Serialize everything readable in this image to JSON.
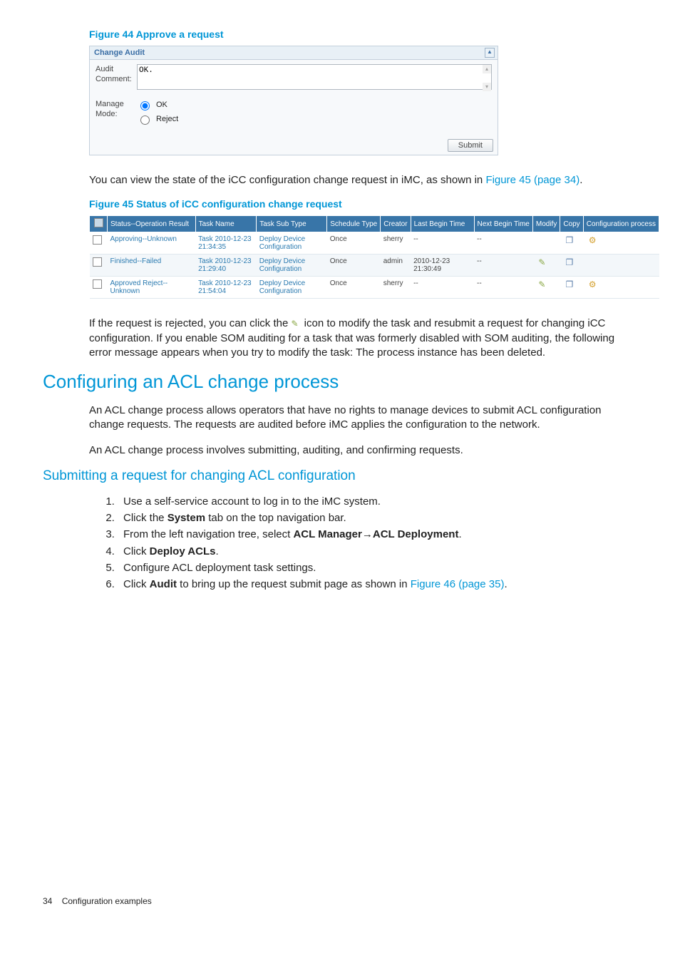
{
  "figure44": {
    "caption": "Figure 44 Approve a request",
    "panelTitle": "Change Audit",
    "auditCommentLabel": "Audit Comment:",
    "auditCommentValue": "OK.",
    "manageModeLabel": "Manage Mode:",
    "modeOK": "OK",
    "modeReject": "Reject",
    "submitLabel": "Submit"
  },
  "para1_before": "You can view the state of the iCC configuration change request in iMC, as shown in ",
  "para1_link": "Figure 45 (page 34)",
  "para1_after": ".",
  "figure45": {
    "caption": "Figure 45 Status of iCC configuration change request",
    "headers": {
      "status": "Status--Operation Result",
      "taskName": "Task Name",
      "taskSubType": "Task Sub Type",
      "scheduleType": "Schedule Type",
      "creator": "Creator",
      "lastBegin": "Last Begin Time",
      "nextBegin": "Next Begin Time",
      "modify": "Modify",
      "copy": "Copy",
      "configProcess": "Configuration process"
    },
    "rows": [
      {
        "status": "Approving--Unknown",
        "taskName": "Task 2010-12-23 21:34:35",
        "taskSubType": "Deploy Device Configuration",
        "scheduleType": "Once",
        "creator": "sherry",
        "lastBegin": "--",
        "nextBegin": "--",
        "modify": false,
        "copy": true,
        "config": true
      },
      {
        "status": "Finished--Failed",
        "taskName": "Task 2010-12-23 21:29:40",
        "taskSubType": "Deploy Device Configuration",
        "scheduleType": "Once",
        "creator": "admin",
        "lastBegin": "2010-12-23 21:30:49",
        "nextBegin": "--",
        "modify": true,
        "copy": true,
        "config": false
      },
      {
        "status": "Approved Reject--Unknown",
        "taskName": "Task 2010-12-23 21:54:04",
        "taskSubType": "Deploy Device Configuration",
        "scheduleType": "Once",
        "creator": "sherry",
        "lastBegin": "--",
        "nextBegin": "--",
        "modify": true,
        "copy": true,
        "config": true
      }
    ]
  },
  "para2_before": "If the request is rejected, you can click the ",
  "para2_after": " icon to modify the task and resubmit a request for changing iCC configuration. If you enable SOM auditing for a task that was formerly disabled with SOM auditing, the following error message appears when you try to modify the task: The process instance has been deleted.",
  "heading1": "Configuring an ACL change process",
  "para3": "An ACL change process allows operators that have no rights to manage devices to submit ACL configuration change requests. The requests are audited before iMC applies the configuration to the network.",
  "para4": "An ACL change process involves submitting, auditing, and confirming requests.",
  "heading2": "Submitting a request for changing ACL configuration",
  "steps": {
    "s1": "Use a self-service account to log in to the iMC system.",
    "s2_a": "Click the ",
    "s2_b": "System",
    "s2_c": " tab on the top navigation bar.",
    "s3_a": "From the left navigation tree, select ",
    "s3_b": "ACL Manager",
    "s3_c": "→",
    "s3_d": "ACL Deployment",
    "s3_e": ".",
    "s4_a": "Click ",
    "s4_b": "Deploy ACLs",
    "s4_c": ".",
    "s5": "Configure ACL deployment task settings.",
    "s6_a": "Click ",
    "s6_b": "Audit",
    "s6_c": " to bring up the request submit page as shown in ",
    "s6_link": "Figure 46 (page 35)",
    "s6_d": "."
  },
  "footer": {
    "pageNum": "34",
    "section": "Configuration examples"
  }
}
